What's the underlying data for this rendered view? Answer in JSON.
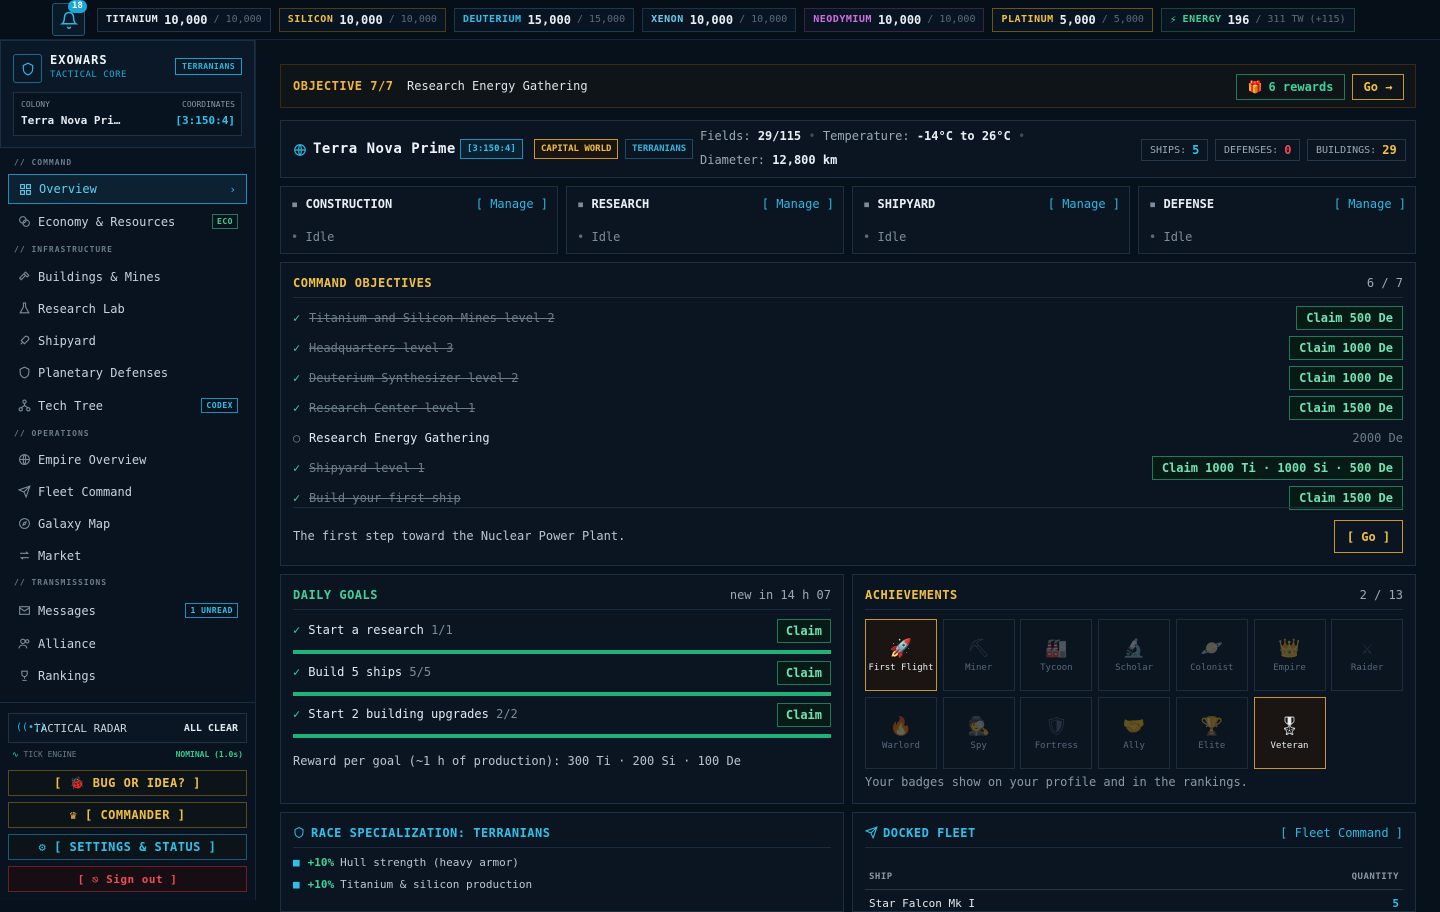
{
  "notifications": {
    "count": "18"
  },
  "resources": [
    {
      "name": "TITANIUM",
      "value": "10,000",
      "max": "/ 10,000",
      "color": "#e8eef3",
      "border": "#223447"
    },
    {
      "name": "SILICON",
      "value": "10,000",
      "max": "/ 10,000",
      "color": "#f0c040",
      "border": "#4a3e18"
    },
    {
      "name": "DEUTERIUM",
      "value": "15,000",
      "max": "/ 15,000",
      "color": "#2fc0ea",
      "border": "#1c3a4e"
    },
    {
      "name": "XENON",
      "value": "10,000",
      "max": "/ 10,000",
      "color": "#6fc8e8",
      "border": "#1c3447"
    },
    {
      "name": "NEODYMIUM",
      "value": "10,000",
      "max": "/ 10,000",
      "color": "#d070e0",
      "border": "#3a2444"
    },
    {
      "name": "PLATINUM",
      "value": "5,000",
      "max": "/ 5,000",
      "color": "#f0c040",
      "border": "#6a5418"
    },
    {
      "name": "ENERGY",
      "value": "196",
      "max": "/ 311 TW (+115)",
      "color": "#3fd196",
      "border": "#1d4436"
    }
  ],
  "sidebar": {
    "brand_title": "EXOWARS",
    "brand_sub": "TACTICAL CORE",
    "race_tag": "TERRANIANS",
    "colony_label": "COLONY",
    "colony_value": "Terra Nova Pri…",
    "coords_label": "COORDINATES",
    "coords_value": "[3:150:4]",
    "sections": {
      "command": "// COMMAND",
      "infrastructure": "// INFRASTRUCTURE",
      "operations": "// OPERATIONS",
      "transmissions": "// TRANSMISSIONS"
    },
    "items": {
      "overview": "Overview",
      "economy": "Economy & Resources",
      "economy_tag": "ECO",
      "buildings": "Buildings & Mines",
      "research": "Research Lab",
      "shipyard": "Shipyard",
      "defenses": "Planetary Defenses",
      "techtree": "Tech Tree",
      "techtree_tag": "CODEX",
      "empire": "Empire Overview",
      "fleet": "Fleet Command",
      "galaxy": "Galaxy Map",
      "market": "Market",
      "messages": "Messages",
      "messages_tag": "1 UNREAD",
      "alliance": "Alliance",
      "rankings": "Rankings"
    },
    "radar_label": "TACTICAL RADAR",
    "radar_status": "ALL CLEAR",
    "tick_label": "TICK ENGINE",
    "tick_status": "NOMINAL (1.0s)",
    "bug_label": "[ 🐞 BUG OR IDEA? ]",
    "commander_label": "♛ [ COMMANDER ]",
    "settings_label": "⚙ [ SETTINGS & STATUS ]",
    "signout_label": "[ ⎋ Sign out ]"
  },
  "objective": {
    "title": "OBJECTIVE 7/7",
    "name": "Research Energy Gathering",
    "rewards": "6 rewards",
    "go": "Go →"
  },
  "planet": {
    "name": "Terra Nova Prime",
    "coords": "[3:150:4]",
    "capital": "CAPITAL WORLD",
    "race": "TERRANIANS",
    "fields_label": "Fields:",
    "fields": "29/115",
    "temp_label": "Temperature:",
    "temp": "-14°C to 26°C",
    "diameter_label": "Diameter:",
    "diameter": "12,800 km",
    "ships_label": "SHIPS:",
    "ships": "5",
    "defenses_label": "DEFENSES:",
    "defenses": "0",
    "buildings_label": "BUILDINGS:",
    "buildings": "29"
  },
  "queues": [
    {
      "title": "CONSTRUCTION",
      "manage": "[ Manage ]",
      "status": "Idle"
    },
    {
      "title": "RESEARCH",
      "manage": "[ Manage ]",
      "status": "Idle"
    },
    {
      "title": "SHIPYARD",
      "manage": "[ Manage ]",
      "status": "Idle"
    },
    {
      "title": "DEFENSE",
      "manage": "[ Manage ]",
      "status": "Idle"
    }
  ],
  "command_objectives": {
    "title": "COMMAND OBJECTIVES",
    "progress": "6 / 7",
    "items": [
      {
        "text": "Titanium and Silicon Mines level 2",
        "done": true,
        "action": "Claim 500 De"
      },
      {
        "text": "Headquarters level 3",
        "done": true,
        "action": "Claim 1000 De"
      },
      {
        "text": "Deuterium Synthesizer level 2",
        "done": true,
        "action": "Claim 1000 De"
      },
      {
        "text": "Research Center level 1",
        "done": true,
        "action": "Claim 1500 De"
      },
      {
        "text": "Research Energy Gathering",
        "done": false,
        "action": "2000 De"
      },
      {
        "text": "Shipyard level 1",
        "done": true,
        "action": "Claim 1000 Ti · 1000 Si · 500 De"
      },
      {
        "text": "Build your first ship",
        "done": true,
        "action": "Claim 1500 De"
      }
    ],
    "hint": "The first step toward the Nuclear Power Plant.",
    "go": "[ Go ]"
  },
  "daily": {
    "title": "DAILY GOALS",
    "timer": "new in 14 h 07",
    "goals": [
      {
        "text": "Start a research",
        "progress": "1/1",
        "action": "Claim",
        "fraction": 1.0
      },
      {
        "text": "Build 5 ships",
        "progress": "5/5",
        "action": "Claim",
        "fraction": 1.0
      },
      {
        "text": "Start 2 building upgrades",
        "progress": "2/2",
        "action": "Claim",
        "fraction": 1.0
      }
    ],
    "reward": "Reward per goal (~1 h of production): 300 Ti · 200 Si · 100 De"
  },
  "achievements": {
    "title": "ACHIEVEMENTS",
    "progress": "2 / 13",
    "badges": [
      {
        "name": "First Flight",
        "icon": "🚀",
        "earned": true
      },
      {
        "name": "Miner",
        "icon": "⛏",
        "earned": false
      },
      {
        "name": "Tycoon",
        "icon": "🏭",
        "earned": false
      },
      {
        "name": "Scholar",
        "icon": "🔬",
        "earned": false
      },
      {
        "name": "Colonist",
        "icon": "🪐",
        "earned": false
      },
      {
        "name": "Empire",
        "icon": "👑",
        "earned": false
      },
      {
        "name": "Raider",
        "icon": "⚔",
        "earned": false
      },
      {
        "name": "Warlord",
        "icon": "🔥",
        "earned": false
      },
      {
        "name": "Spy",
        "icon": "🕵",
        "earned": false
      },
      {
        "name": "Fortress",
        "icon": "🛡",
        "earned": false
      },
      {
        "name": "Ally",
        "icon": "🤝",
        "earned": false
      },
      {
        "name": "Elite",
        "icon": "🏆",
        "earned": false
      },
      {
        "name": "Veteran",
        "icon": "🎖",
        "earned": true
      }
    ],
    "footer": "Your badges show on your profile and in the rankings."
  },
  "race": {
    "title": "RACE SPECIALIZATION: TERRANIANS",
    "bonuses": [
      {
        "value": "+10%",
        "text": "Hull strength (heavy armor)"
      },
      {
        "value": "+10%",
        "text": "Titanium & silicon production"
      }
    ]
  },
  "fleet": {
    "title": "DOCKED FLEET",
    "link": "[ Fleet Command ]",
    "col_ship": "SHIP",
    "col_qty": "QUANTITY",
    "rows": [
      {
        "ship": "Star Falcon Mk I",
        "qty": "5"
      }
    ]
  }
}
